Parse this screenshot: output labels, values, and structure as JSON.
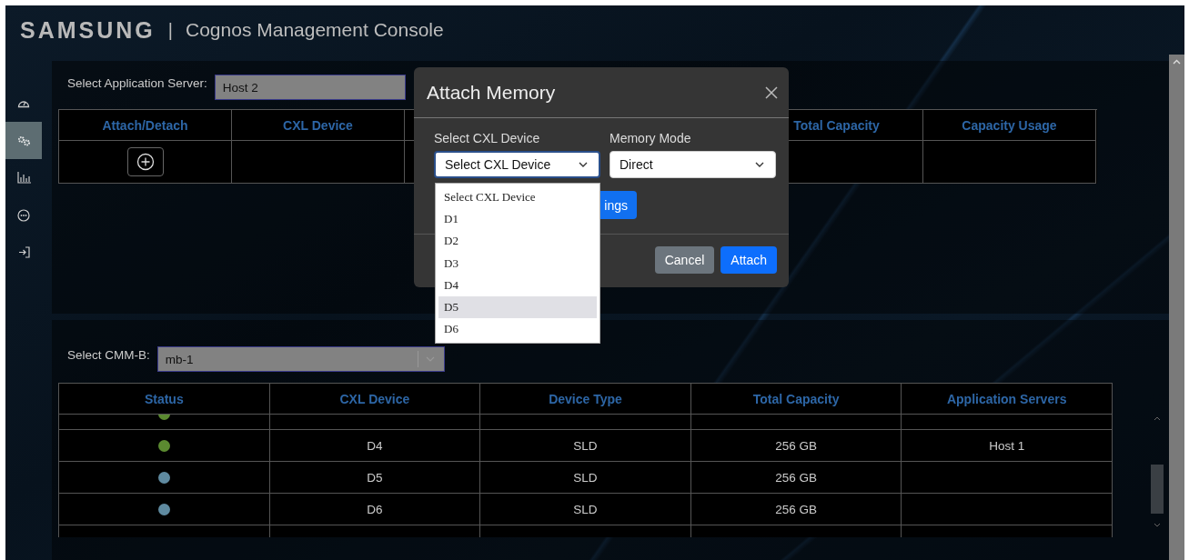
{
  "header": {
    "logo": "SAMSUNG",
    "separator": "|",
    "title": "Cognos Management Console"
  },
  "sidebar": {
    "items": [
      {
        "kind": "gauge",
        "selected": false
      },
      {
        "kind": "gears",
        "selected": true
      },
      {
        "kind": "chart",
        "selected": false
      },
      {
        "kind": "more",
        "selected": false
      },
      {
        "kind": "login",
        "selected": false
      }
    ]
  },
  "server_select": {
    "label": "Select Application Server:",
    "value": "Host 2"
  },
  "attach_table": {
    "columns": [
      "Attach/Detach",
      "CXL Device",
      "Total Capacity",
      "Capacity Usage"
    ]
  },
  "cmm_select": {
    "label": "Select CMM-B:",
    "value": "mb-1"
  },
  "device_table": {
    "columns": [
      "Status",
      "CXL Device",
      "Device Type",
      "Total Capacity",
      "Application Servers"
    ],
    "rows": [
      {
        "color": "#5b8a30",
        "cells": [
          "",
          "",
          "",
          "",
          ""
        ]
      },
      {
        "color": "#5b8a30",
        "cells": [
          "",
          "D4",
          "SLD",
          "256 GB",
          "Host 1"
        ]
      },
      {
        "color": "#5f8aa0",
        "cells": [
          "",
          "D5",
          "SLD",
          "256 GB",
          ""
        ]
      },
      {
        "color": "#5f8aa0",
        "cells": [
          "",
          "D6",
          "SLD",
          "256 GB",
          ""
        ]
      }
    ]
  },
  "dialog": {
    "title": "Attach Memory",
    "device_label": "Select CXL Device",
    "device_value": "Select CXL Device",
    "mode_label": "Memory Mode",
    "mode_value": "Direct",
    "settings_button": "ings",
    "buttons": [
      {
        "label": "Cancel",
        "kind": "secondary"
      },
      {
        "label": "Attach",
        "kind": "primary"
      }
    ]
  },
  "dropdown": {
    "options": [
      {
        "label": "Select CXL Device",
        "selected": false
      },
      {
        "label": "D1",
        "selected": false
      },
      {
        "label": "D2",
        "selected": false
      },
      {
        "label": "D3",
        "selected": false
      },
      {
        "label": "D4",
        "selected": false
      },
      {
        "label": "D5",
        "selected": true
      },
      {
        "label": "D6",
        "selected": false
      }
    ]
  }
}
